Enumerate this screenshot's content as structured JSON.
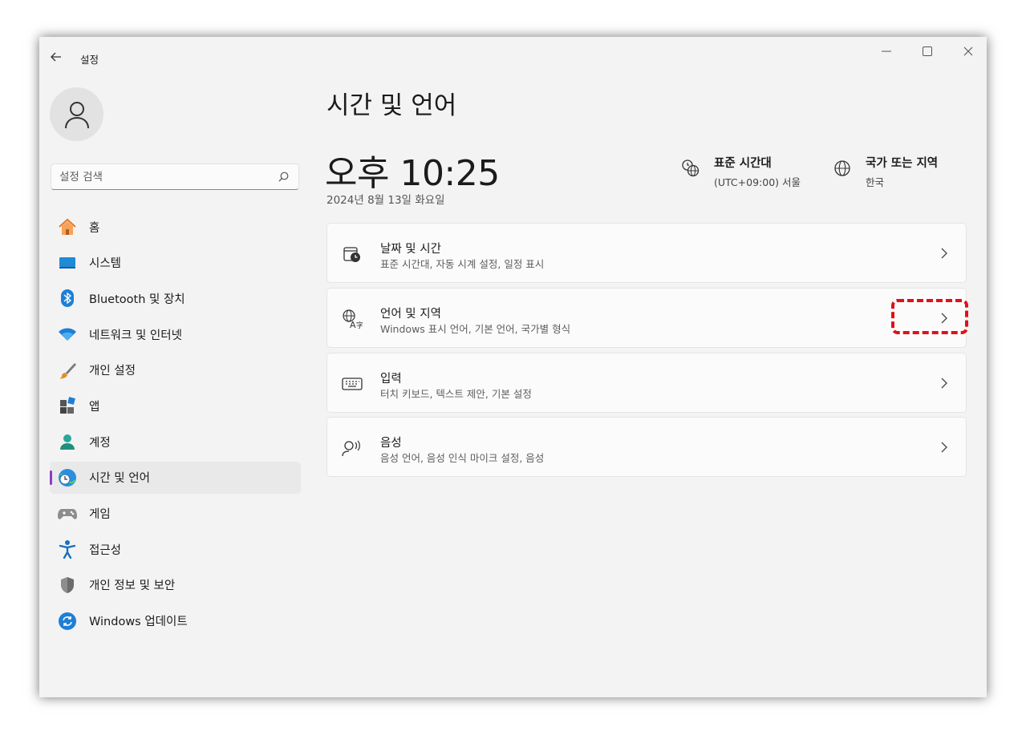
{
  "window": {
    "app_title": "설정",
    "controls": [
      "minimize",
      "maximize",
      "close"
    ]
  },
  "sidebar": {
    "search": {
      "placeholder": "설정 검색",
      "value": ""
    },
    "items": [
      {
        "label": "홈",
        "icon": "home-icon",
        "active": false
      },
      {
        "label": "시스템",
        "icon": "system-icon",
        "active": false
      },
      {
        "label": "Bluetooth 및 장치",
        "icon": "bluetooth-icon",
        "active": false
      },
      {
        "label": "네트워크 및 인터넷",
        "icon": "wifi-icon",
        "active": false
      },
      {
        "label": "개인 설정",
        "icon": "brush-icon",
        "active": false
      },
      {
        "label": "앱",
        "icon": "apps-icon",
        "active": false
      },
      {
        "label": "계정",
        "icon": "account-icon",
        "active": false
      },
      {
        "label": "시간 및 언어",
        "icon": "time-language-icon",
        "active": true
      },
      {
        "label": "게임",
        "icon": "gamepad-icon",
        "active": false
      },
      {
        "label": "접근성",
        "icon": "accessibility-icon",
        "active": false
      },
      {
        "label": "개인 정보 및 보안",
        "icon": "shield-icon",
        "active": false
      },
      {
        "label": "Windows 업데이트",
        "icon": "update-icon",
        "active": false
      }
    ]
  },
  "main": {
    "title": "시간 및 언어",
    "time": "오후 10:25",
    "date": "2024년 8월 13일 화요일",
    "timezone": {
      "title": "표준 시간대",
      "value": "(UTC+09:00) 서울"
    },
    "region": {
      "title": "국가 또는 지역",
      "value": "한국"
    },
    "cards": [
      {
        "title": "날짜 및 시간",
        "subtitle": "표준 시간대, 자동 시계 설정, 일정 표시",
        "icon": "calendar-clock-icon"
      },
      {
        "title": "언어 및 지역",
        "subtitle": "Windows 표시 언어, 기본 언어, 국가별 형식",
        "icon": "language-icon"
      },
      {
        "title": "입력",
        "subtitle": "터치 키보드, 텍스트 제안, 기본 설정",
        "icon": "keyboard-icon"
      },
      {
        "title": "음성",
        "subtitle": "음성 언어, 음성 인식 마이크 설정, 음성",
        "icon": "speech-icon"
      }
    ]
  },
  "colors": {
    "accent": "#8a3cc7",
    "highlight": "#e0101a",
    "window_bg": "#f3f3f3"
  }
}
